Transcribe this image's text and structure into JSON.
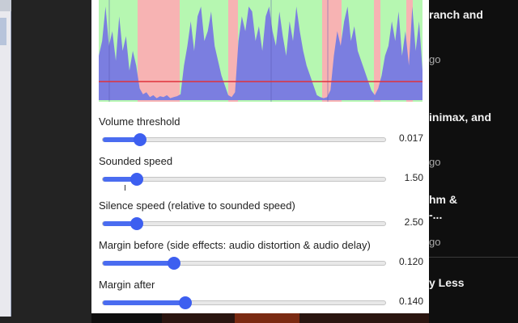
{
  "chart_colors": {
    "sounded_bg": "#b6f7b1",
    "silence_bg": "#f7b3b3",
    "volume_fill": "#7b7ee0",
    "threshold_line": "#e0323a"
  },
  "chart_data": {
    "type": "area",
    "title": "",
    "xlabel": "",
    "ylabel": "",
    "threshold": 0.017,
    "segments": [
      {
        "kind": "sounded",
        "start": 0.0,
        "end": 0.12
      },
      {
        "kind": "silence",
        "start": 0.12,
        "end": 0.25
      },
      {
        "kind": "sounded",
        "start": 0.25,
        "end": 0.4
      },
      {
        "kind": "silence",
        "start": 0.4,
        "end": 0.43
      },
      {
        "kind": "sounded",
        "start": 0.43,
        "end": 0.69
      },
      {
        "kind": "silence",
        "start": 0.69,
        "end": 0.75
      },
      {
        "kind": "sounded",
        "start": 0.75,
        "end": 0.85
      },
      {
        "kind": "silence",
        "start": 0.85,
        "end": 0.87
      },
      {
        "kind": "sounded",
        "start": 0.87,
        "end": 0.95
      },
      {
        "kind": "silence",
        "start": 0.95,
        "end": 0.97
      },
      {
        "kind": "sounded",
        "start": 0.97,
        "end": 1.0
      }
    ],
    "volume": [
      0.45,
      0.6,
      0.95,
      0.55,
      0.7,
      0.4,
      0.85,
      0.5,
      0.65,
      0.3,
      0.5,
      0.35,
      0.12,
      0.06,
      0.08,
      0.03,
      0.05,
      0.02,
      0.04,
      0.03,
      0.05,
      0.02,
      0.03,
      0.04,
      0.06,
      0.35,
      0.55,
      0.8,
      0.5,
      0.85,
      0.95,
      0.6,
      0.7,
      0.9,
      0.55,
      0.4,
      0.25,
      0.15,
      0.05,
      0.03,
      0.08,
      0.6,
      0.85,
      0.7,
      0.95,
      0.9,
      0.6,
      0.75,
      0.5,
      0.85,
      0.95,
      0.7,
      0.55,
      0.9,
      0.65,
      0.45,
      0.8,
      0.6,
      0.95,
      0.7,
      0.5,
      0.35,
      0.25,
      0.15,
      0.05,
      0.03,
      0.02,
      0.03,
      0.1,
      0.45,
      0.7,
      0.55,
      0.8,
      0.95,
      0.6,
      0.75,
      0.5,
      0.4,
      0.3,
      0.2,
      0.1,
      0.05,
      0.12,
      0.25,
      0.45,
      0.55,
      0.8,
      0.6,
      0.9,
      0.45,
      0.7,
      0.35,
      0.95,
      0.5,
      0.8,
      0.3
    ]
  },
  "controls": [
    {
      "id": "volume-threshold",
      "label": "Volume threshold",
      "value": "0.017",
      "position": 0.13
    },
    {
      "id": "sounded-speed",
      "label": "Sounded speed",
      "value": "1.50",
      "position": 0.12
    },
    {
      "id": "silence-speed",
      "label": "Silence speed (relative to sounded speed)",
      "value": "2.50",
      "position": 0.12
    },
    {
      "id": "margin-before",
      "label": "Margin before (side effects: audio distortion & audio delay)",
      "value": "0.120",
      "position": 0.25
    },
    {
      "id": "margin-after",
      "label": "Margin after",
      "value": "0.140",
      "position": 0.29
    }
  ],
  "background_videos": [
    {
      "title": "ranch and",
      "meta": "go"
    },
    {
      "title": "inimax, and",
      "meta": "go"
    },
    {
      "title": "hm &",
      "title2": "-...",
      "meta": "go"
    },
    {
      "title": "y Less",
      "meta": ""
    }
  ]
}
